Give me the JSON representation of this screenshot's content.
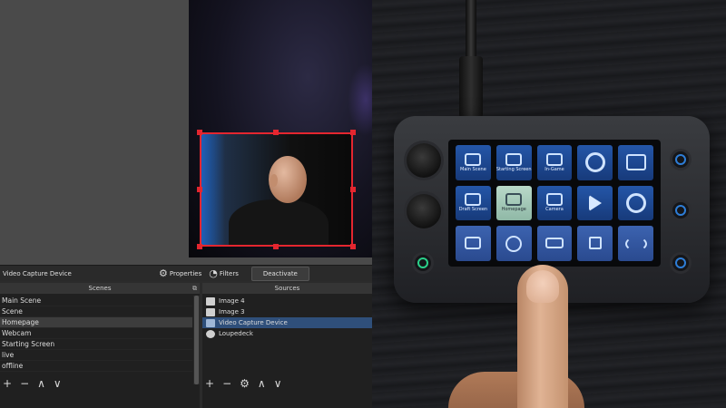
{
  "obs": {
    "source_toolbar": {
      "selected_source": "Video Capture Device",
      "properties_label": "Properties",
      "filters_label": "Filters",
      "deactivate_label": "Deactivate"
    },
    "scenes": {
      "title": "Scenes",
      "items": [
        "Main Scene",
        "Scene",
        "Homepage",
        "Webcam",
        "Starting Screen",
        "live",
        "offline"
      ],
      "selected": "Homepage"
    },
    "sources": {
      "title": "Sources",
      "items": [
        {
          "name": "Image 4",
          "icon": "image-icon"
        },
        {
          "name": "Image 3",
          "icon": "image-icon"
        },
        {
          "name": "Video Capture Device",
          "icon": "camera-icon"
        },
        {
          "name": "Loupedeck",
          "icon": "globe-icon"
        }
      ],
      "selected": "Video Capture Device"
    },
    "footer_icons": {
      "add": "+",
      "remove": "−",
      "settings": "⚙",
      "up": "∧",
      "down": "∨"
    }
  },
  "loupedeck": {
    "keys": [
      {
        "label": "Main Scene",
        "icon": "scene-icon"
      },
      {
        "label": "Starting Screen",
        "icon": "scene-icon"
      },
      {
        "label": "In-Game",
        "icon": "scene-icon"
      },
      {
        "label": "",
        "icon": "webcam-icon"
      },
      {
        "label": "",
        "icon": "grid-monitor-icon"
      },
      {
        "label": "Draft Screen",
        "icon": "scene-icon"
      },
      {
        "label": "Homepage",
        "icon": "scene-icon"
      },
      {
        "label": "Camera",
        "icon": "scene-icon"
      },
      {
        "label": "",
        "icon": "fast-forward-icon"
      },
      {
        "label": "",
        "icon": "record-icon"
      },
      {
        "label": "",
        "icon": "screen-icon"
      },
      {
        "label": "",
        "icon": "coin-icon"
      },
      {
        "label": "",
        "icon": "ticket-icon"
      },
      {
        "label": "",
        "icon": "playstation-icon"
      },
      {
        "label": "",
        "icon": "broadcast-icon"
      }
    ],
    "accent_color": "#2456a8",
    "active_key_color": "#b9d9c9"
  }
}
